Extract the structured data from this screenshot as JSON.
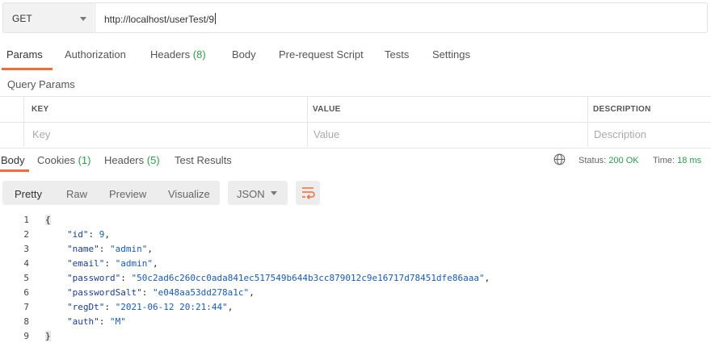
{
  "request": {
    "method": "GET",
    "url": "http://localhost/userTest/9"
  },
  "request_tabs": [
    {
      "label": "Params",
      "count": ""
    },
    {
      "label": "Authorization",
      "count": ""
    },
    {
      "label": "Headers",
      "count": "(8)"
    },
    {
      "label": "Body",
      "count": ""
    },
    {
      "label": "Pre-request Script",
      "count": ""
    },
    {
      "label": "Tests",
      "count": ""
    },
    {
      "label": "Settings",
      "count": ""
    }
  ],
  "query_params": {
    "title": "Query Params",
    "headers": [
      "KEY",
      "VALUE",
      "DESCRIPTION"
    ],
    "placeholders": [
      "Key",
      "Value",
      "Description"
    ]
  },
  "response_tabs": [
    {
      "label": "Body",
      "count": ""
    },
    {
      "label": "Cookies",
      "count": "(1)"
    },
    {
      "label": "Headers",
      "count": "(5)"
    },
    {
      "label": "Test Results",
      "count": ""
    }
  ],
  "response_status": {
    "status_label": "Status:",
    "status_value": "200 OK",
    "time_label": "Time:",
    "time_value": "18 ms"
  },
  "view_modes": [
    "Pretty",
    "Raw",
    "Preview",
    "Visualize"
  ],
  "format": "JSON",
  "icons": {
    "method_dropdown": "chevron-down-icon",
    "globe": "globe-icon",
    "wrap": "wrap-lines-icon",
    "format_dropdown": "chevron-down-icon"
  },
  "colors": {
    "accent": "#f26b3a",
    "count_green": "#2e9a4b"
  },
  "response_body": [
    {
      "n": "1",
      "text": "{"
    },
    {
      "n": "2",
      "key": "\"id\"",
      "value": "9",
      "type": "num",
      "comma": ","
    },
    {
      "n": "3",
      "key": "\"name\"",
      "value": "\"admin\"",
      "type": "str",
      "comma": ","
    },
    {
      "n": "4",
      "key": "\"email\"",
      "value": "\"admin\"",
      "type": "str",
      "comma": ","
    },
    {
      "n": "5",
      "key": "\"password\"",
      "value": "\"50c2ad6c260cc0ada841ec517549b644b3cc879012c9e16717d78451dfe86aaa\"",
      "type": "str",
      "comma": ","
    },
    {
      "n": "6",
      "key": "\"passwordSalt\"",
      "value": "\"e048aa53dd278a1c\"",
      "type": "str",
      "comma": ","
    },
    {
      "n": "7",
      "key": "\"regDt\"",
      "value": "\"2021-06-12 20:21:44\"",
      "type": "str",
      "comma": ","
    },
    {
      "n": "8",
      "key": "\"auth\"",
      "value": "\"M\"",
      "type": "str",
      "comma": ""
    },
    {
      "n": "9",
      "text": "}"
    }
  ]
}
